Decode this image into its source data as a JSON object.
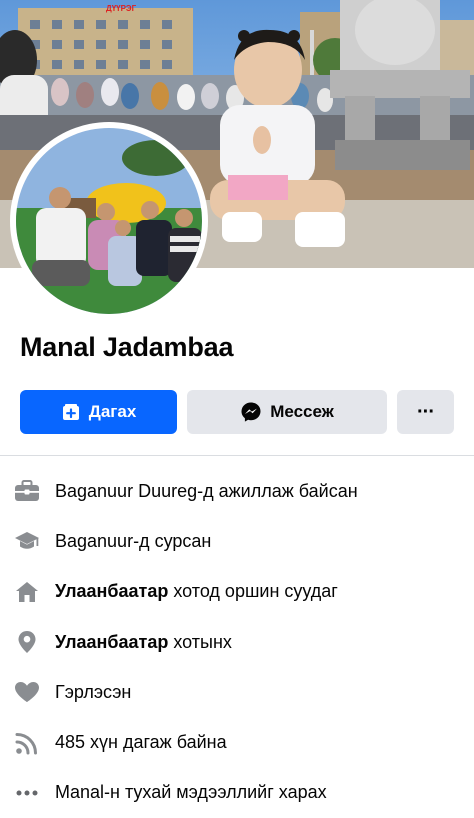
{
  "profile": {
    "name": "Manal Jadambaa"
  },
  "cover": {
    "sign_text": "ДҮҮРЭГ"
  },
  "actions": {
    "follow_label": "Дагах",
    "message_label": "Мессеж",
    "more_label": "···"
  },
  "info": {
    "work": "Baganuur Duureg-д ажиллаж байсан",
    "education": "Baganuur-д сурсан",
    "lives_city": "Улаанбаатар",
    "lives_suffix": " хотод оршин суудаг",
    "from_city": "Улаанбаатар",
    "from_suffix": " хотынх",
    "relationship": "Гэрлэсэн",
    "followers": "485 хүн дагаж байна",
    "about": "Manal-н тухай мэдээллийг харах"
  },
  "colors": {
    "primary": "#0866ff",
    "button_gray": "#e4e6eb",
    "icon_gray": "#8a8d91",
    "text": "#050505"
  },
  "icons": [
    "briefcase-icon",
    "graduation-cap-icon",
    "home-icon",
    "location-pin-icon",
    "heart-icon",
    "rss-icon",
    "more-dots-icon"
  ]
}
